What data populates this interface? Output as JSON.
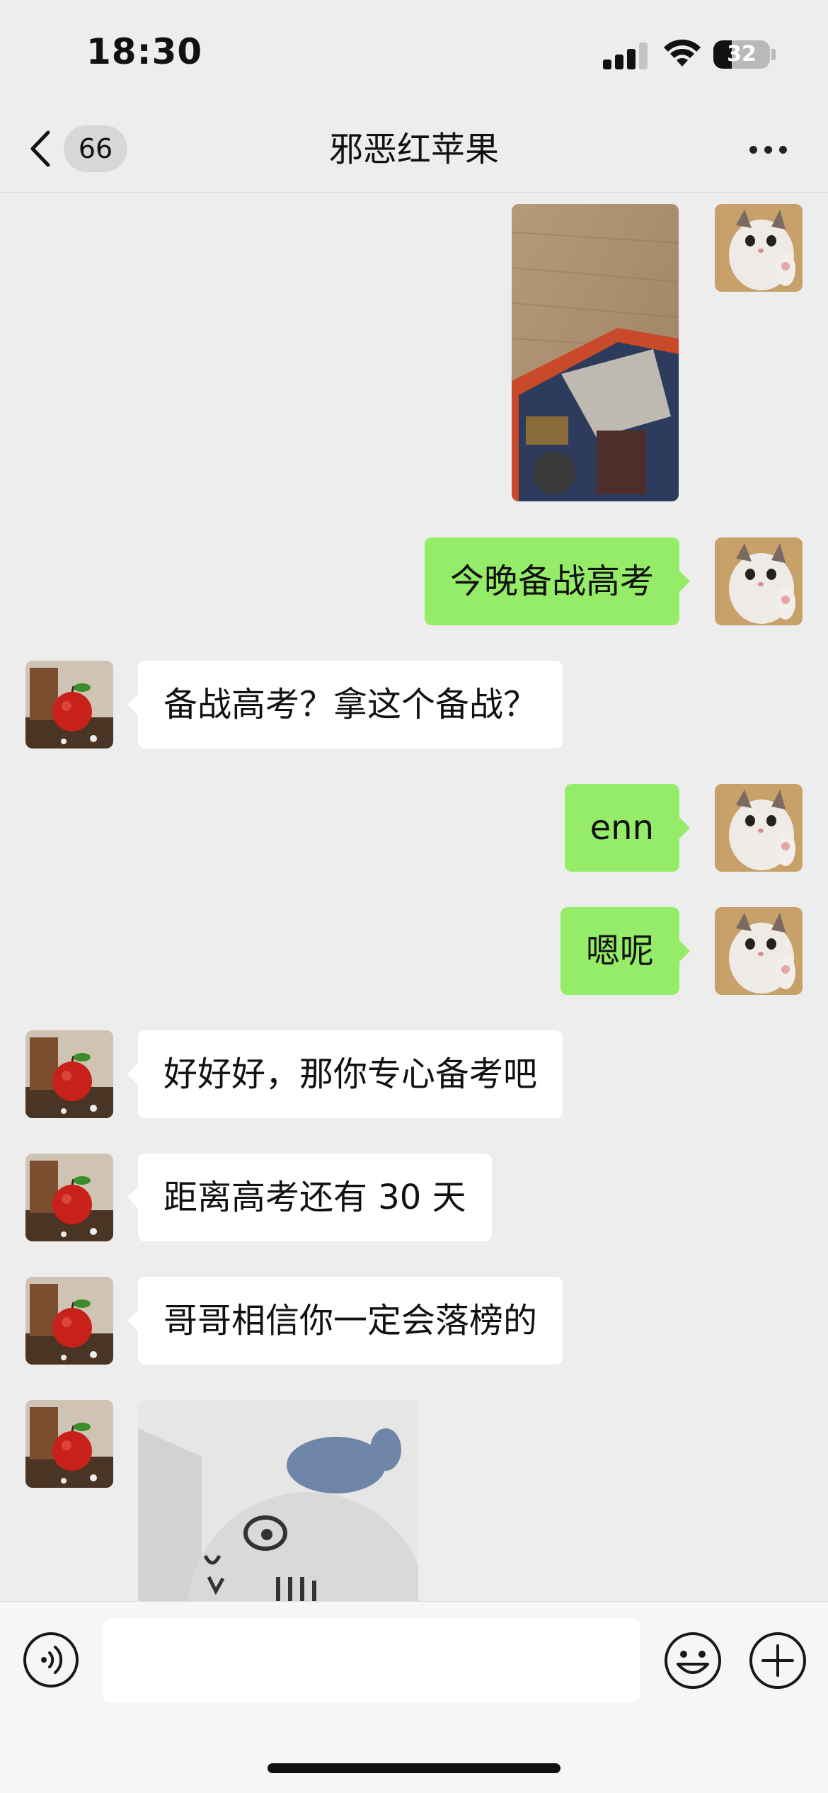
{
  "status_bar": {
    "time": "18:30",
    "battery": "32",
    "battery_level": 0.32
  },
  "nav": {
    "unread_count": "66",
    "title": "邪恶红苹果"
  },
  "icons": {
    "back": "chevron-left-icon",
    "more": "more-dots-icon",
    "voice": "voice-icon",
    "emoji": "smiley-icon",
    "plus": "plus-icon"
  },
  "colors": {
    "sent_bubble": "#95ec69",
    "received_bubble": "#ffffff",
    "background": "#ededed"
  },
  "messages": [
    {
      "sender": "me",
      "type": "image",
      "content": "photo of board game box on wooden table"
    },
    {
      "sender": "me",
      "type": "text",
      "text": "今晚备战高考"
    },
    {
      "sender": "them",
      "type": "text",
      "text": "备战高考？拿这个备战？"
    },
    {
      "sender": "me",
      "type": "text",
      "text": "enn"
    },
    {
      "sender": "me",
      "type": "text",
      "text": "嗯呢"
    },
    {
      "sender": "them",
      "type": "text",
      "text": "好好好，那你专心备考吧"
    },
    {
      "sender": "them",
      "type": "text",
      "text": "距离高考还有 30 天"
    },
    {
      "sender": "them",
      "type": "text",
      "text": "哥哥相信你一定会落榜的"
    },
    {
      "sender": "them",
      "type": "image",
      "content": "photo of plush toy"
    }
  ],
  "input": {
    "value": "",
    "placeholder": ""
  }
}
